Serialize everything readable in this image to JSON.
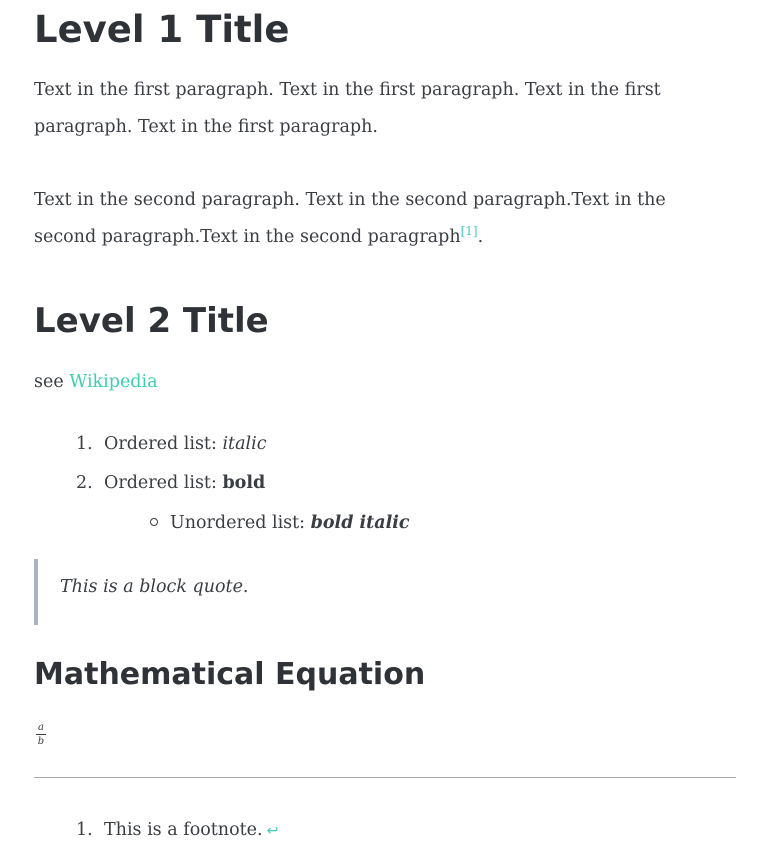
{
  "headings": {
    "level1": "Level 1 Title",
    "level2": "Level 2 Title",
    "math": "Mathematical Equation"
  },
  "paragraphs": {
    "first": "Text in the first paragraph. Text in the first paragraph. Text in the first paragraph. Text in the first paragraph.",
    "second": "Text in the second paragraph. Text in the second paragraph.Text in the second paragraph.Text in the second paragraph",
    "second_footnote_ref": "[1]",
    "second_end": "."
  },
  "see_line": {
    "prefix": "see ",
    "link_text": "Wikipedia"
  },
  "ordered_list": [
    {
      "number": "1.",
      "prefix": "Ordered list: ",
      "styled": "italic"
    },
    {
      "number": "2.",
      "prefix": "Ordered list: ",
      "styled": "bold"
    }
  ],
  "unordered_list": [
    {
      "prefix": "Unordered list: ",
      "styled": "bold italic"
    }
  ],
  "blockquote": "This is a block quote.",
  "equation": {
    "numerator": "a",
    "denominator": "b"
  },
  "footnotes": [
    {
      "number": "1.",
      "text": "This is a footnote.",
      "backref": "↩"
    }
  ],
  "colors": {
    "text": "#3a3d42",
    "heading": "#2f3237",
    "link": "#3ecfb0",
    "quote_border": "#a9b3c1",
    "rule": "#a8aaaf"
  }
}
